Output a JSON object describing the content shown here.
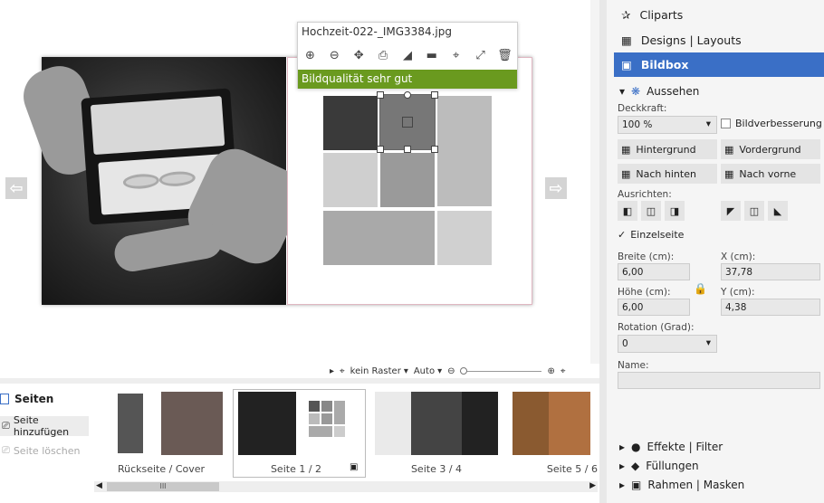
{
  "toolbar": {
    "filename": "Hochzeit-022-_IMG3384.jpg",
    "quality_text": "Bildqualität sehr gut",
    "icons": [
      "zoom-in-icon",
      "zoom-out-icon",
      "move-icon",
      "replace-icon",
      "flip-icon",
      "align-icon",
      "crop-icon",
      "fit-icon",
      "delete-icon"
    ],
    "quality_color": "#6a9a1f"
  },
  "zoombar": {
    "grid": "kein Raster",
    "zoom": "Auto"
  },
  "pages": {
    "title": "Seiten",
    "add": "Seite hinzufügen",
    "delete": "Seite löschen",
    "thumbs": [
      {
        "label": "Rückseite / Cover"
      },
      {
        "label": "Seite 1 / 2"
      },
      {
        "label": "Seite 3 / 4"
      },
      {
        "label": "Seite 5 / 6"
      }
    ]
  },
  "panel": {
    "nav": [
      {
        "label": "Cliparts"
      },
      {
        "label": "Designs | Layouts"
      },
      {
        "label": "Bildbox"
      }
    ],
    "section": "Aussehen",
    "opacity_label": "Deckkraft:",
    "opacity": "100 %",
    "enhance": "Bildverbesserung",
    "btn_bg": "Hintergrund",
    "btn_fg": "Vordergrund",
    "btn_back": "Nach hinten",
    "btn_front": "Nach vorne",
    "align_label": "Ausrichten:",
    "single_page": "Einzelseite",
    "width_label": "Breite (cm):",
    "width": "6,00",
    "x_label": "X (cm):",
    "x": "37,78",
    "height_label": "Höhe (cm):",
    "height": "6,00",
    "y_label": "Y (cm):",
    "y": "4,38",
    "rotation_label": "Rotation (Grad):",
    "rotation": "0",
    "name_label": "Name:",
    "effects": "Effekte | Filter",
    "fills": "Füllungen",
    "frames": "Rahmen | Masken",
    "accent": "#3a6fc6"
  }
}
